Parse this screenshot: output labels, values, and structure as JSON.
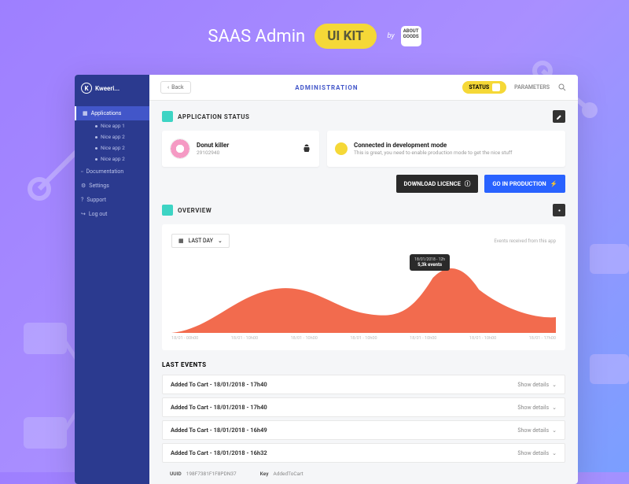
{
  "promo": {
    "title": "SAAS Admin",
    "pill": "UI KIT",
    "by": "by",
    "logo": "ABOUT GOODS"
  },
  "sidebar": {
    "brand": "Kweeri...",
    "items": [
      {
        "label": "Applications",
        "active": true,
        "sub": [
          "Nice app 1",
          "Nice app 2",
          "Nice app 2",
          "Nice app 2"
        ]
      },
      {
        "label": "Documentation"
      },
      {
        "label": "Settings"
      },
      {
        "label": "Support"
      },
      {
        "label": "Log out"
      }
    ]
  },
  "topbar": {
    "back": "Back",
    "title": "ADMINISTRATION",
    "status": "STATUS",
    "params": "PARAMETERS"
  },
  "status_section": {
    "title": "APPLICATION STATUS",
    "app": {
      "name": "Donut killer",
      "id": "29102940"
    },
    "conn": {
      "title": "Connected in development mode",
      "sub": "This is great, you need to enable production mode to get the nice stuff"
    },
    "btn_licence": "DOWNLOAD LICENCE",
    "btn_prod": "GO IN PRODUCTION"
  },
  "overview": {
    "title": "OVERVIEW",
    "period": "LAST DAY",
    "legend": "Events received from this app",
    "tooltip": {
      "date": "18/01/2018 - 12h",
      "value": "5,3k events"
    }
  },
  "chart_data": {
    "type": "area",
    "categories": [
      "18/01 - 00h00",
      "18/01 - 10h00",
      "18/01 - 10h00",
      "18/01 - 10h00",
      "18/01 - 10h00",
      "18/01 - 10h00",
      "18/01 - 17h00"
    ],
    "values": [
      0,
      20,
      35,
      18,
      15,
      55,
      20
    ],
    "ylim": [
      0,
      75
    ],
    "title": "",
    "xlabel": "",
    "ylabel": ""
  },
  "events": {
    "title": "LAST EVENTS",
    "detail": "Show details",
    "rows": [
      {
        "label": "Added To Cart - 18/01/2018 - 17h40"
      },
      {
        "label": "Added To Cart - 18/01/2018 - 17h40"
      },
      {
        "label": "Added To Cart - 18/01/2018 - 16h49"
      },
      {
        "label": "Added To Cart - 18/01/2018 - 16h32",
        "expanded": true,
        "uuid": "198F7381F1F8PDN37",
        "key": "AddedToCart"
      }
    ]
  }
}
